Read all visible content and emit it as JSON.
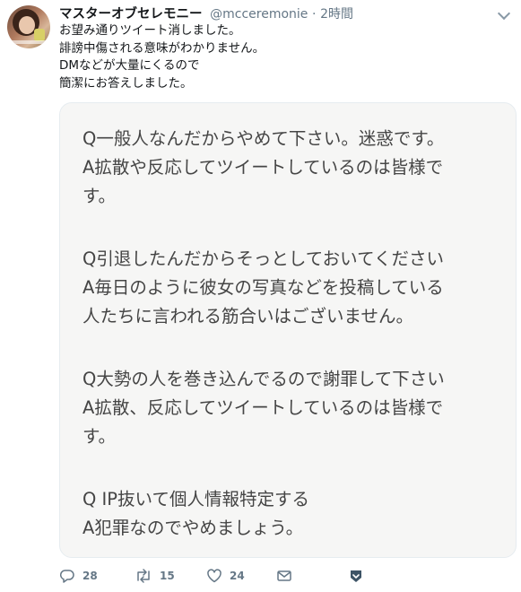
{
  "tweet": {
    "display_name": "マスターオブセレモニー",
    "handle": "@mcceremonie",
    "separator": "·",
    "time": "2時間",
    "text_lines": [
      "お望み通りツイート消しました。",
      "誹謗中傷される意味がわかりません。",
      "DMなどが大量にくるので",
      "簡潔にお答えしました。"
    ]
  },
  "image_text": {
    "lines": [
      "Q一般人なんだからやめて下さい。迷惑です。",
      "A拡散や反応してツイートしているのは皆様で",
      "す。",
      "",
      "Q引退したんだからそっとしておいてください",
      "A毎日のように彼女の写真などを投稿している",
      "人たちに言われる筋合いはございません。",
      "",
      "Q大勢の人を巻き込んでるので謝罪して下さい",
      "A拡散、反応してツイートしているのは皆様で",
      "す。",
      "",
      "Q IP抜いて個人情報特定する",
      "A犯罪なのでやめましょう。"
    ]
  },
  "actions": {
    "reply_count": "28",
    "retweet_count": "15",
    "like_count": "24"
  },
  "icons": {
    "reply": "reply-icon",
    "retweet": "retweet-icon",
    "like": "heart-icon",
    "dm": "envelope-icon",
    "save": "bookmark-icon",
    "more": "chevron-down-icon"
  },
  "colors": {
    "secondary_text": "#657786",
    "save_icon": "#3d5466",
    "card_bg": "#f6f6f5"
  }
}
